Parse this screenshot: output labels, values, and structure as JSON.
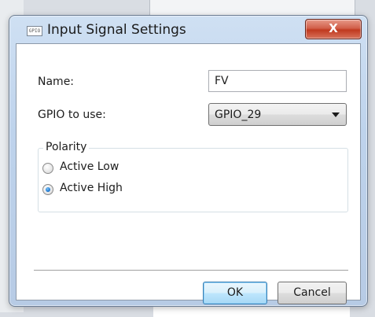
{
  "window": {
    "title": "Input Signal Settings",
    "icon_text": "GPIO",
    "close_label": "X"
  },
  "form": {
    "name_label": "Name:",
    "name_value": "FV",
    "gpio_label": "GPIO to use:",
    "gpio_value": "GPIO_29"
  },
  "polarity": {
    "legend": "Polarity",
    "options": [
      {
        "label": "Active Low",
        "checked": false
      },
      {
        "label": "Active High",
        "checked": true
      }
    ]
  },
  "buttons": {
    "ok_label": "OK",
    "cancel_label": "Cancel"
  },
  "colors": {
    "frame": "#bed3ec",
    "close": "#c0391f",
    "default_button": "#bee6fd"
  }
}
